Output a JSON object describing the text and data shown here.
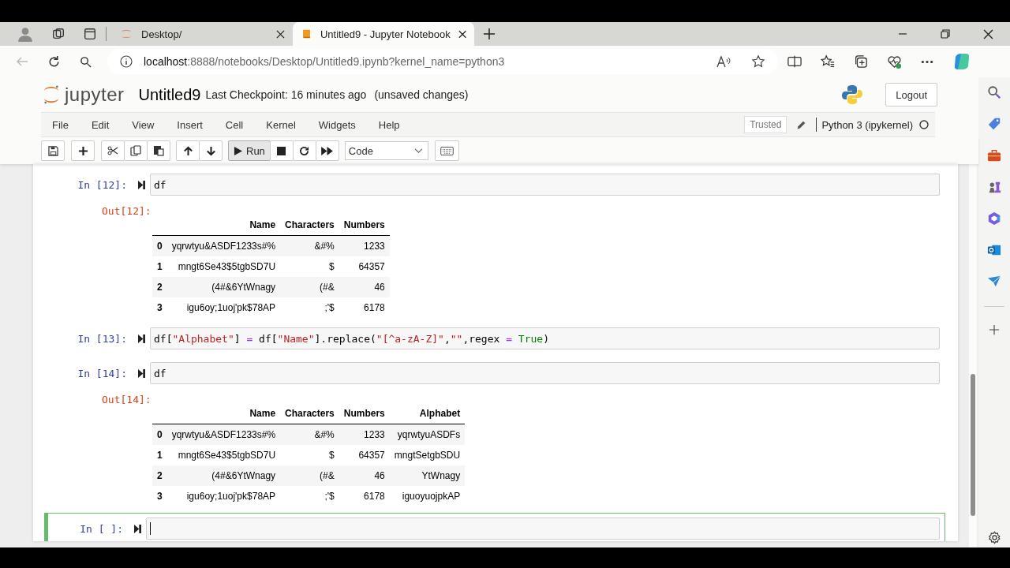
{
  "browser": {
    "tabs": [
      {
        "title": "Desktop/",
        "selected": false,
        "kind": "jupyter"
      },
      {
        "title": "Untitled9 - Jupyter Notebook",
        "selected": true,
        "kind": "notebook"
      }
    ],
    "url_host": "localhost",
    "url_rest": ":8888/notebooks/Desktop/Untitled9.ipynb?kernel_name=python3"
  },
  "header": {
    "logo_text": "jupyter",
    "notebook_name": "Untitled9",
    "checkpoint": "Last Checkpoint: 16 minutes ago",
    "save_status": "(unsaved changes)",
    "logout": "Logout"
  },
  "menu": {
    "items": [
      "File",
      "Edit",
      "View",
      "Insert",
      "Cell",
      "Kernel",
      "Widgets",
      "Help"
    ],
    "trusted": "Trusted",
    "kernel": "Python 3 (ipykernel)"
  },
  "toolbar": {
    "run": "Run",
    "cell_type": "Code"
  },
  "cells": [
    {
      "prompt": "In [12]:",
      "selected": false,
      "code": [
        {
          "text": "df",
          "kind": "plain"
        }
      ],
      "output": {
        "prompt": "Out[12]:",
        "columns": [
          "Name",
          "Characters",
          "Numbers"
        ],
        "rows": [
          {
            "index": "0",
            "cells": [
              "yqrwtyu&ASDF1233s#%",
              "&#%",
              "1233"
            ]
          },
          {
            "index": "1",
            "cells": [
              "mngt6Se43$5tgbSD7U",
              "$",
              "64357"
            ]
          },
          {
            "index": "2",
            "cells": [
              "(4#&6YtWnagy",
              "(#&",
              "46"
            ]
          },
          {
            "index": "3",
            "cells": [
              "igu6oy;1uoj'pk$78AP",
              ";'$",
              "6178"
            ]
          }
        ]
      }
    },
    {
      "prompt": "In [13]:",
      "selected": false,
      "code": [
        {
          "text": "df[",
          "kind": "plain"
        },
        {
          "text": "\"Alphabet\"",
          "kind": "string"
        },
        {
          "text": "]",
          "kind": "plain"
        },
        {
          "text": " = ",
          "kind": "operator"
        },
        {
          "text": "df[",
          "kind": "plain"
        },
        {
          "text": "\"Name\"",
          "kind": "string"
        },
        {
          "text": "].replace(",
          "kind": "plain"
        },
        {
          "text": "\"[^a-zA-Z]\"",
          "kind": "string"
        },
        {
          "text": ",",
          "kind": "plain"
        },
        {
          "text": "\"\"",
          "kind": "string"
        },
        {
          "text": ",regex",
          "kind": "plain"
        },
        {
          "text": " = ",
          "kind": "operator"
        },
        {
          "text": "True",
          "kind": "keyword"
        },
        {
          "text": ")",
          "kind": "plain"
        }
      ]
    },
    {
      "prompt": "In [14]:",
      "selected": false,
      "code": [
        {
          "text": "df",
          "kind": "plain"
        }
      ],
      "output": {
        "prompt": "Out[14]:",
        "columns": [
          "Name",
          "Characters",
          "Numbers",
          "Alphabet"
        ],
        "rows": [
          {
            "index": "0",
            "cells": [
              "yqrwtyu&ASDF1233s#%",
              "&#%",
              "1233",
              "yqrwtyuASDFs"
            ]
          },
          {
            "index": "1",
            "cells": [
              "mngt6Se43$5tgbSD7U",
              "$",
              "64357",
              "mngtSetgbSDU"
            ]
          },
          {
            "index": "2",
            "cells": [
              "(4#&6YtWnagy",
              "(#&",
              "46",
              "YtWnagy"
            ]
          },
          {
            "index": "3",
            "cells": [
              "igu6oy;1uoj'pk$78AP",
              ";'$",
              "6178",
              "iguoyuojpkAP"
            ]
          }
        ]
      }
    },
    {
      "prompt": "In [ ]:",
      "selected": true
    }
  ]
}
